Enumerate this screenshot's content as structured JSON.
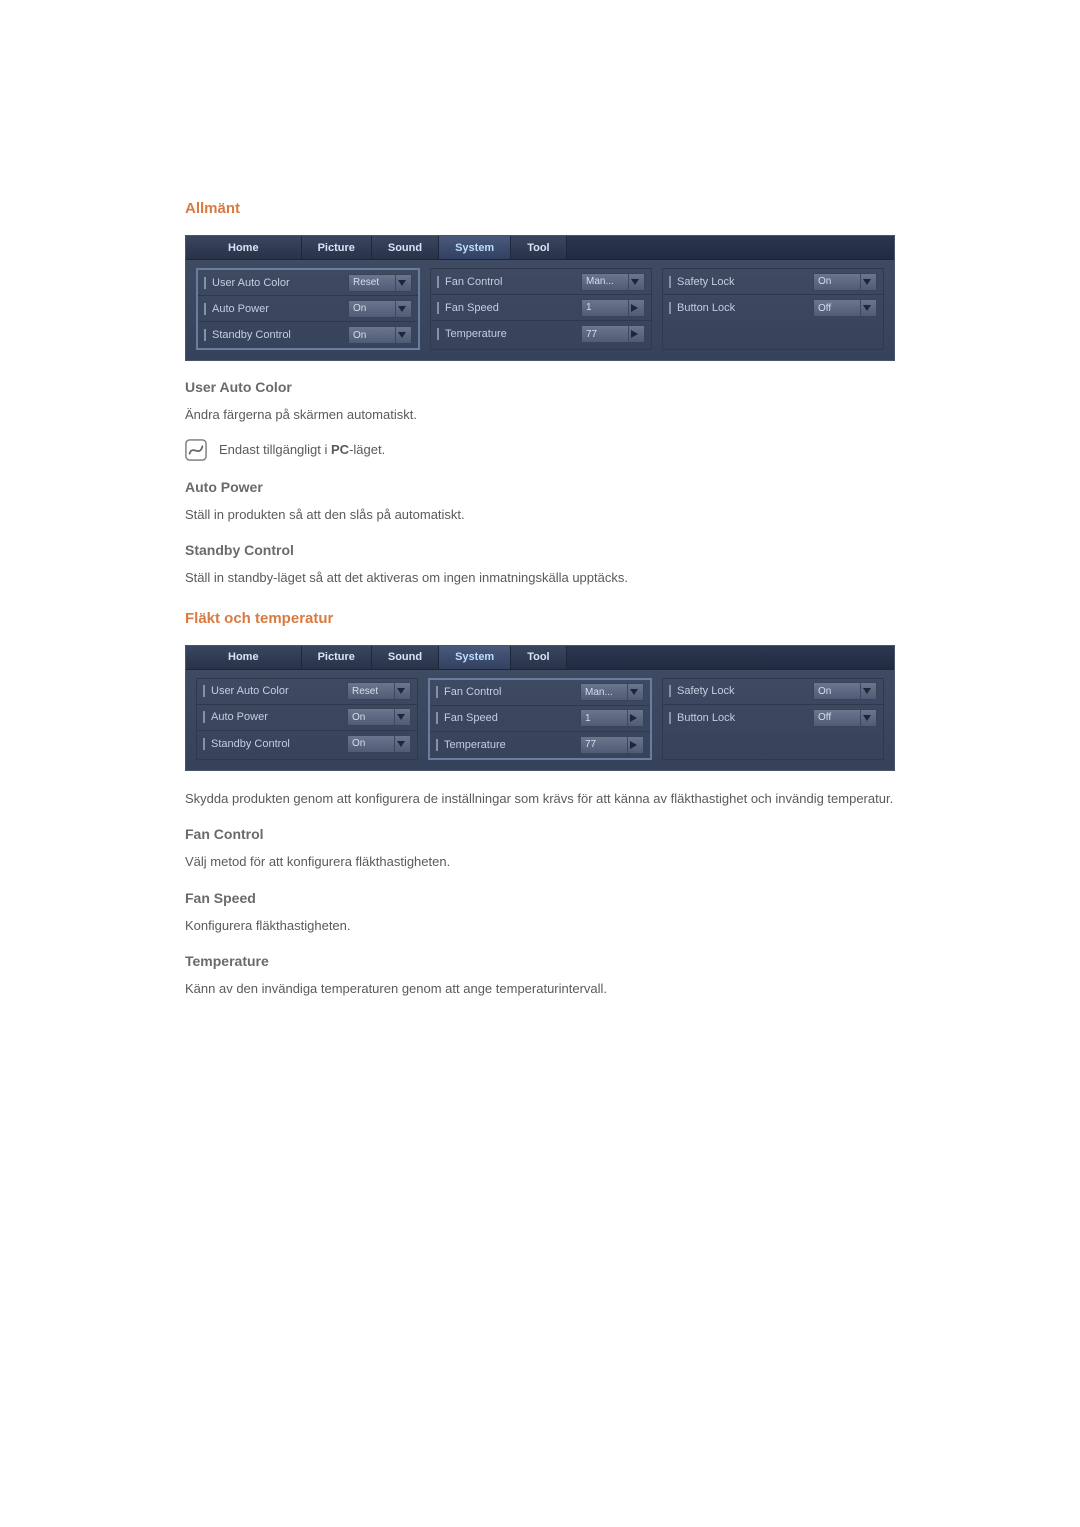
{
  "section1": {
    "heading": "Allmänt",
    "userAutoColor": {
      "title": "User Auto Color",
      "text": "Ändra färgerna på skärmen automatiskt.",
      "note_prefix": "Endast tillgängligt i ",
      "note_bold": "PC",
      "note_suffix": "-läget."
    },
    "autoPower": {
      "title": "Auto Power",
      "text": "Ställ in produkten så att den slås på automatiskt."
    },
    "standbyControl": {
      "title": "Standby Control",
      "text": "Ställ in standby-läget så att det aktiveras om ingen inmatningskälla upptäcks."
    }
  },
  "section2": {
    "heading": "Fläkt och temperatur",
    "intro": "Skydda produkten genom att konfigurera de inställningar som krävs för att känna av fläkthastighet och invändig temperatur.",
    "fanControl": {
      "title": "Fan Control",
      "text": "Välj metod för att konfigurera fläkthastigheten."
    },
    "fanSpeed": {
      "title": "Fan Speed",
      "text": "Konfigurera fläkthastigheten."
    },
    "temperature": {
      "title": "Temperature",
      "text": "Känn av den invändiga temperaturen genom att ange temperaturintervall."
    }
  },
  "panel": {
    "tabs": [
      "Home",
      "Picture",
      "Sound",
      "System",
      "Tool"
    ],
    "activeTab": "System",
    "col1": [
      {
        "label": "User Auto Color",
        "value": "Reset",
        "type": "caret"
      },
      {
        "label": "Auto Power",
        "value": "On",
        "type": "caret"
      },
      {
        "label": "Standby Control",
        "value": "On",
        "type": "caret"
      }
    ],
    "col2": [
      {
        "label": "Fan Control",
        "value": "Man...",
        "type": "caret"
      },
      {
        "label": "Fan Speed",
        "value": "1",
        "type": "arrow"
      },
      {
        "label": "Temperature",
        "value": "77",
        "type": "arrow"
      }
    ],
    "col3": [
      {
        "label": "Safety Lock",
        "value": "On",
        "type": "caret"
      },
      {
        "label": "Button Lock",
        "value": "Off",
        "type": "caret"
      }
    ]
  },
  "panelHighlight": {
    "first": 0,
    "second": 1
  }
}
